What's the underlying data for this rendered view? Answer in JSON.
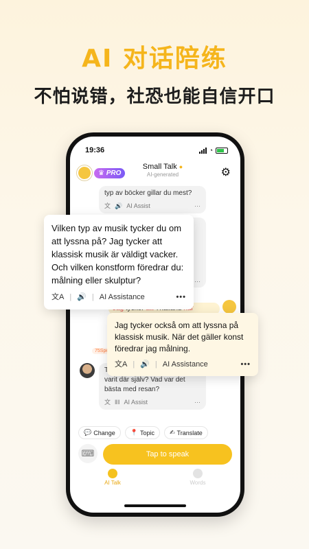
{
  "hero": {
    "title": "AI 对话陪练",
    "subtitle": "不怕说错，社恐也能自信开口"
  },
  "status": {
    "time": "19:36"
  },
  "header": {
    "pro": "PRO",
    "title": "Small Talk",
    "subtitle": "AI-generated"
  },
  "chat": {
    "msg1": "typ av böcker gillar du mest?",
    "msg1_assist": "AI Assist",
    "msg2_assist": "AI Assist",
    "user_snippet_a": "Jag",
    "user_snippet_b": "tycker",
    "user_snippet_c": "att",
    "user_snippet_d": "Thailand",
    "user_snippet_e": "när",
    "date_label": "75Spe",
    "msg3": "Thailand låter häftigt. Har du varit där själv? Vad var det bästa med resan?",
    "msg3_assist": "AI Assist"
  },
  "overlays": {
    "left_text": "Vilken typ av musik tycker du om att lyssna på? Jag tycker att klassisk musik är väldigt vacker. Och vilken konstform föredrar du: målning eller skulptur?",
    "left_tool": "AI Assistance",
    "right_text": "Jag tycker också om att lyssna på klassisk musik. När det gäller konst föredrar jag målning.",
    "right_tool": "AI Assistance",
    "more": "•••"
  },
  "chips": [
    {
      "icon": "💬",
      "label": "Change"
    },
    {
      "icon": "📍",
      "label": "Topic"
    },
    {
      "icon": "✍",
      "label": "Translate"
    }
  ],
  "input": {
    "speak": "Tap to speak"
  },
  "tabs": {
    "ai_talk": "AI Talk",
    "words": "Words"
  },
  "colors": {
    "accent": "#f7c21f",
    "pro_gradient_start": "#c96bf0",
    "pro_gradient_end": "#7a5af5",
    "highlight": "#e65a5a"
  }
}
